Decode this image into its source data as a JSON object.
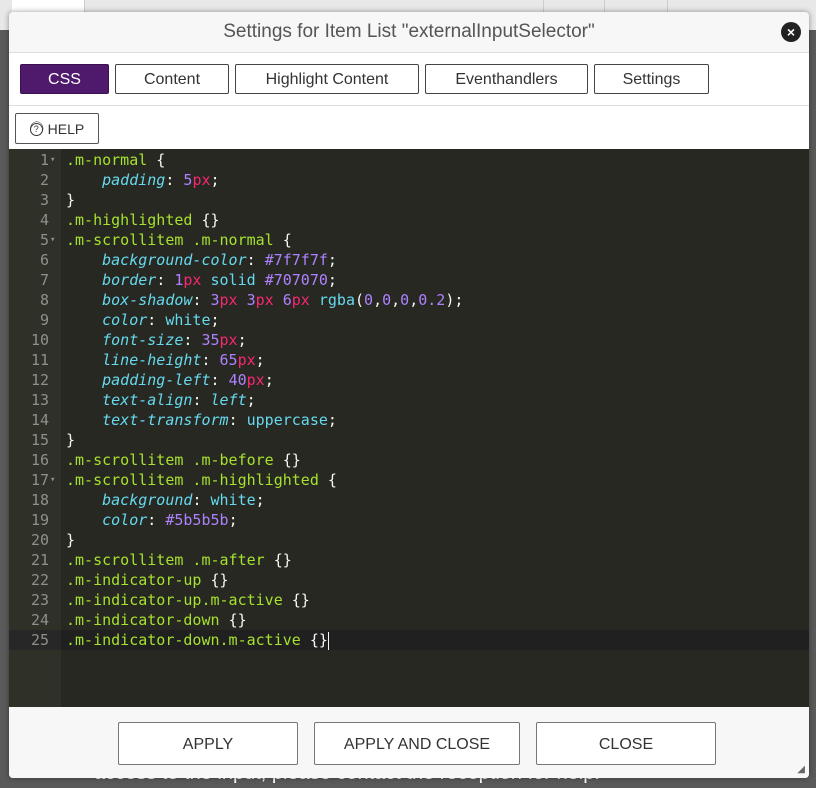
{
  "background": {
    "text": "access to the input, please contact the reception for help."
  },
  "dialog": {
    "title": "Settings for Item List \"externalInputSelector\"",
    "close_icon": "×",
    "tabs": [
      {
        "label": "CSS",
        "active": true
      },
      {
        "label": "Content"
      },
      {
        "label": "Highlight Content"
      },
      {
        "label": "Eventhandlers"
      },
      {
        "label": "Settings"
      }
    ],
    "help_label": "⓪ HELP",
    "help_icon": "?",
    "help_text": "HELP",
    "editor": {
      "active_line": 25,
      "colors": {
        "background": "#272822",
        "selector": "#a6e22e",
        "property": "#66d9ef",
        "number": "#ae81ff",
        "unit": "#f92672"
      },
      "lines": [
        [
          [
            "s",
            ".m-normal"
          ],
          [
            "t",
            " {"
          ]
        ],
        [
          [
            "t",
            "    "
          ],
          [
            "p",
            "padding"
          ],
          [
            "t",
            ": "
          ],
          [
            "n",
            "5"
          ],
          [
            "u",
            "px"
          ],
          [
            "t",
            ";"
          ]
        ],
        [
          [
            "t",
            "}"
          ]
        ],
        [
          [
            "s",
            ".m-highlighted"
          ],
          [
            "t",
            " {}"
          ]
        ],
        [
          [
            "s",
            ".m-scrollitem .m-normal"
          ],
          [
            "t",
            " {"
          ]
        ],
        [
          [
            "t",
            "    "
          ],
          [
            "p",
            "background-color"
          ],
          [
            "t",
            ": "
          ],
          [
            "c",
            "#7f7f7f"
          ],
          [
            "t",
            ";"
          ]
        ],
        [
          [
            "t",
            "    "
          ],
          [
            "p",
            "border"
          ],
          [
            "t",
            ": "
          ],
          [
            "n",
            "1"
          ],
          [
            "u",
            "px"
          ],
          [
            "t",
            " "
          ],
          [
            "v",
            "solid"
          ],
          [
            "t",
            " "
          ],
          [
            "c",
            "#707070"
          ],
          [
            "t",
            ";"
          ]
        ],
        [
          [
            "t",
            "    "
          ],
          [
            "p",
            "box-shadow"
          ],
          [
            "t",
            ": "
          ],
          [
            "n",
            "3"
          ],
          [
            "u",
            "px"
          ],
          [
            "t",
            " "
          ],
          [
            "n",
            "3"
          ],
          [
            "u",
            "px"
          ],
          [
            "t",
            " "
          ],
          [
            "n",
            "6"
          ],
          [
            "u",
            "px"
          ],
          [
            "t",
            " "
          ],
          [
            "v",
            "rgba"
          ],
          [
            "t",
            "("
          ],
          [
            "n",
            "0"
          ],
          [
            "t",
            ","
          ],
          [
            "n",
            "0"
          ],
          [
            "t",
            ","
          ],
          [
            "n",
            "0"
          ],
          [
            "t",
            ","
          ],
          [
            "n",
            "0.2"
          ],
          [
            "t",
            ");"
          ]
        ],
        [
          [
            "t",
            "    "
          ],
          [
            "p",
            "color"
          ],
          [
            "t",
            ": "
          ],
          [
            "v",
            "white"
          ],
          [
            "t",
            ";"
          ]
        ],
        [
          [
            "t",
            "    "
          ],
          [
            "p",
            "font-size"
          ],
          [
            "t",
            ": "
          ],
          [
            "n",
            "35"
          ],
          [
            "u",
            "px"
          ],
          [
            "t",
            ";"
          ]
        ],
        [
          [
            "t",
            "    "
          ],
          [
            "p",
            "line-height"
          ],
          [
            "t",
            ": "
          ],
          [
            "n",
            "65"
          ],
          [
            "u",
            "px"
          ],
          [
            "t",
            ";"
          ]
        ],
        [
          [
            "t",
            "    "
          ],
          [
            "p",
            "padding-left"
          ],
          [
            "t",
            ": "
          ],
          [
            "n",
            "40"
          ],
          [
            "u",
            "px"
          ],
          [
            "t",
            ";"
          ]
        ],
        [
          [
            "t",
            "    "
          ],
          [
            "p",
            "text-align"
          ],
          [
            "t",
            ": "
          ],
          [
            "i",
            "left"
          ],
          [
            "t",
            ";"
          ]
        ],
        [
          [
            "t",
            "    "
          ],
          [
            "p",
            "text-transform"
          ],
          [
            "t",
            ": "
          ],
          [
            "v",
            "uppercase"
          ],
          [
            "t",
            ";"
          ]
        ],
        [
          [
            "t",
            "}"
          ]
        ],
        [
          [
            "s",
            ".m-scrollitem .m-before"
          ],
          [
            "t",
            " {}"
          ]
        ],
        [
          [
            "s",
            ".m-scrollitem .m-highlighted"
          ],
          [
            "t",
            " {"
          ]
        ],
        [
          [
            "t",
            "    "
          ],
          [
            "p",
            "background"
          ],
          [
            "t",
            ": "
          ],
          [
            "v",
            "white"
          ],
          [
            "t",
            ";"
          ]
        ],
        [
          [
            "t",
            "    "
          ],
          [
            "p",
            "color"
          ],
          [
            "t",
            ": "
          ],
          [
            "c",
            "#5b5b5b"
          ],
          [
            "t",
            ";"
          ]
        ],
        [
          [
            "t",
            "}"
          ]
        ],
        [
          [
            "s",
            ".m-scrollitem .m-after"
          ],
          [
            "t",
            " {}"
          ]
        ],
        [
          [
            "s",
            ".m-indicator-up"
          ],
          [
            "t",
            " {}"
          ]
        ],
        [
          [
            "s",
            ".m-indicator-up.m-active"
          ],
          [
            "t",
            " {}"
          ]
        ],
        [
          [
            "s",
            ".m-indicator-down"
          ],
          [
            "t",
            " {}"
          ]
        ],
        [
          [
            "s",
            ".m-indicator-down.m-active"
          ],
          [
            "t",
            " {}"
          ]
        ]
      ],
      "fold_lines": [
        1,
        5,
        17
      ]
    },
    "footer": {
      "apply": "APPLY",
      "apply_close": "APPLY AND CLOSE",
      "close": "CLOSE"
    }
  }
}
